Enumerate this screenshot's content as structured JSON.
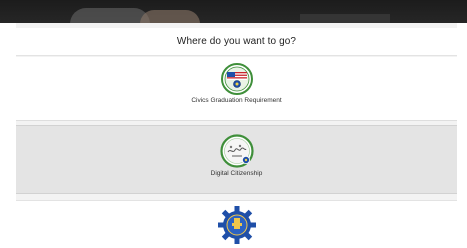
{
  "prompt": {
    "text": "Where do you want to go?"
  },
  "options": [
    {
      "label": "Civics Graduation Requirement",
      "icon": "civics-seal-icon"
    },
    {
      "label": "Digital Citizenship",
      "icon": "digital-citizenship-seal-icon"
    },
    {
      "label": "",
      "icon": "gear-seal-icon"
    }
  ],
  "colors": {
    "hero": "#222222",
    "selected_row": "#e4e4e4",
    "seal_green": "#3f8f3a",
    "seal_blue": "#1f4fa8",
    "flag_red": "#c8242b"
  }
}
